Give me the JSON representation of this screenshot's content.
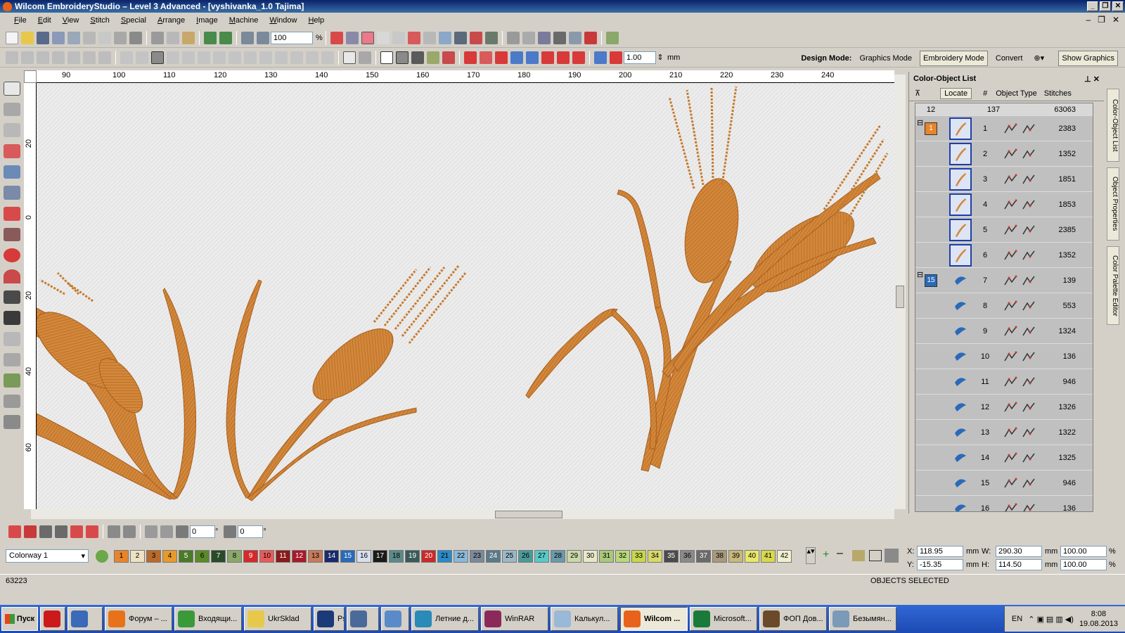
{
  "window": {
    "title": "Wilcom EmbroideryStudio – Level 3 Advanced - [vyshivanka_1.0        Tajima]"
  },
  "menu": [
    "File",
    "Edit",
    "View",
    "Stitch",
    "Special",
    "Arrange",
    "Image",
    "Machine",
    "Window",
    "Help"
  ],
  "toolbar": {
    "zoom": "100",
    "zoom_unit": "%",
    "spacing": "1.00",
    "spacing_unit": "mm"
  },
  "design_mode": {
    "label": "Design Mode:",
    "graphics": "Graphics Mode",
    "embroidery": "Embroidery Mode",
    "convert": "Convert",
    "show_graphics": "Show Graphics"
  },
  "ruler": {
    "h": [
      "90",
      "100",
      "110",
      "120",
      "130",
      "140",
      "150",
      "160",
      "170",
      "180",
      "190",
      "200",
      "210",
      "220",
      "230",
      "240"
    ],
    "v": [
      "20",
      "0",
      "20",
      "40",
      "60"
    ]
  },
  "panel": {
    "title": "Color-Object List",
    "locate": "Locate",
    "hash": "#",
    "object_type": "Object Type",
    "stitches": "Stitches",
    "totals": {
      "colors": "12",
      "objects": "137",
      "stitches": "63063"
    },
    "group1_color": "1",
    "group2_color": "15",
    "rows": [
      {
        "n": "1",
        "st": "2383"
      },
      {
        "n": "2",
        "st": "1352"
      },
      {
        "n": "3",
        "st": "1851"
      },
      {
        "n": "4",
        "st": "1853"
      },
      {
        "n": "5",
        "st": "2385"
      },
      {
        "n": "6",
        "st": "1352"
      },
      {
        "n": "7",
        "st": "139"
      },
      {
        "n": "8",
        "st": "553"
      },
      {
        "n": "9",
        "st": "1324"
      },
      {
        "n": "10",
        "st": "136"
      },
      {
        "n": "11",
        "st": "946"
      },
      {
        "n": "12",
        "st": "1326"
      },
      {
        "n": "13",
        "st": "1322"
      },
      {
        "n": "14",
        "st": "1325"
      },
      {
        "n": "15",
        "st": "946"
      },
      {
        "n": "16",
        "st": "136"
      }
    ]
  },
  "side_tabs": [
    "Color-Object List",
    "Object Properties",
    "Color Palette Editor"
  ],
  "bottom_toolbar": {
    "angle1": "0",
    "angle2": "0",
    "deg": "°"
  },
  "colorway": {
    "selected": "Colorway 1",
    "swatches": [
      "1",
      "2",
      "3",
      "4",
      "5",
      "6",
      "7",
      "8",
      "9",
      "10",
      "11",
      "12",
      "13",
      "14",
      "15",
      "16",
      "17",
      "18",
      "19",
      "20",
      "21",
      "22",
      "23",
      "24",
      "25",
      "26",
      "27",
      "28",
      "29",
      "30",
      "31",
      "32",
      "33",
      "34",
      "35",
      "36",
      "37",
      "38",
      "39",
      "40",
      "41",
      "42"
    ],
    "colors": [
      "#e8842a",
      "#efe2c4",
      "#b86a2a",
      "#e89a2a",
      "#4a7a2a",
      "#5a8a2a",
      "#2a4a2a",
      "#8aa86a",
      "#d42a2a",
      "#e85a5a",
      "#8a1a1a",
      "#a81a2a",
      "#c87a5a",
      "#1a2a6a",
      "#2a6ab8",
      "#d8e0f0",
      "#1a1a1a",
      "#5a8a8a",
      "#3a5a5a",
      "#c82a2a",
      "#2a8ac8",
      "#8ab8d8",
      "#7a8a9a",
      "#5a7a8a",
      "#9ab8c8",
      "#4a9a9a",
      "#5ac8c8",
      "#6a9aaa",
      "#c8d8a8",
      "#e8e8c8",
      "#a8c87a",
      "#b8d87a",
      "#c8d84a",
      "#d8d86a",
      "#4a4a4a",
      "#8a8a8a",
      "#6a6a6a",
      "#a89a7a",
      "#c8b87a",
      "#e8e86a",
      "#d8d84a",
      "#f0f0d0"
    ]
  },
  "coords": {
    "x_label": "X:",
    "x": "118.95",
    "y_label": "Y:",
    "y": "-15.35",
    "w_label": "W:",
    "w": "290.30",
    "h_label": "H:",
    "h": "114.50",
    "unit": "mm",
    "sx": "100.00",
    "sy": "100.00",
    "pct": "%"
  },
  "status": {
    "stitches": "63223",
    "message": "OBJECTS SELECTED"
  },
  "taskbar": {
    "start": "Пуск",
    "tasks": [
      {
        "label": "",
        "w": 36,
        "color": "#cc1a1a"
      },
      {
        "label": "",
        "w": 50,
        "color": "#3a6ab8"
      },
      {
        "label": "Форум – ...",
        "w": 96,
        "color": "#e8721a"
      },
      {
        "label": "Входящи...",
        "w": 96,
        "color": "#3a9a3a"
      },
      {
        "label": "UkrSklad",
        "w": 96,
        "color": "#e8c84a"
      },
      {
        "label": "Ps",
        "w": 44,
        "color": "#1a3a7a"
      },
      {
        "label": "",
        "w": 46,
        "color": "#4a6a9a"
      },
      {
        "label": "",
        "w": 40,
        "color": "#5a8ac8"
      },
      {
        "label": "Летние д...",
        "w": 96,
        "color": "#2a8ab8"
      },
      {
        "label": "WinRAR",
        "w": 96,
        "color": "#8a2a5a"
      },
      {
        "label": "Калькул...",
        "w": 96,
        "color": "#9ab8d8"
      },
      {
        "label": "Wilcom ...",
        "w": 96,
        "color": "#e8621c",
        "active": true
      },
      {
        "label": "Microsoft...",
        "w": 96,
        "color": "#1a7a3a"
      },
      {
        "label": "ФОП Дов...",
        "w": 96,
        "color": "#6a4a2a"
      },
      {
        "label": "Безымян...",
        "w": 96,
        "color": "#7a9ab8"
      }
    ],
    "lang": "EN",
    "time": "8:08",
    "date": "19.08.2013"
  }
}
